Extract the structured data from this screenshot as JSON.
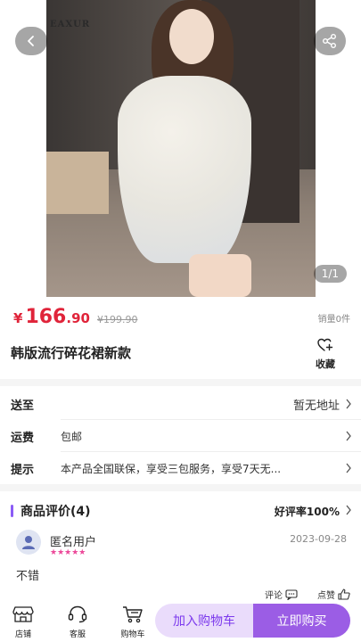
{
  "hero": {
    "brand_watermark": "EAXUR",
    "image_counter": "1/1",
    "back_icon": "chevron-left-icon",
    "share_icon": "share-icon"
  },
  "product": {
    "currency": "¥",
    "price_int": "166",
    "price_dec": ".90",
    "original_price": "¥199.90",
    "sales": "销量0件",
    "title": "韩版流行碎花裙新款",
    "favorite_label": "收藏"
  },
  "info": {
    "ship_to_label": "送至",
    "ship_to_value": "暂无地址",
    "freight_label": "运费",
    "freight_value": "包邮",
    "tips_label": "提示",
    "tips_value": "本产品全国联保，享受三包服务，享受7天无..."
  },
  "reviews": {
    "title": "商品评价(4)",
    "good_rate": "好评率100%",
    "user_name": "匿名用户",
    "stars": "★★★★★",
    "date": "2023-09-28",
    "text": "不错",
    "comment_label": "评论",
    "like_label": "点赞"
  },
  "bottom_bar": {
    "store_label": "店铺",
    "service_label": "客服",
    "cart_label": "购物车",
    "add_cart_label": "加入购物车",
    "buy_now_label": "立即购买"
  },
  "colors": {
    "price": "#e0243a",
    "accent": "#9b5de5",
    "accent_light": "#eadcfb",
    "stars": "#ec4899"
  }
}
